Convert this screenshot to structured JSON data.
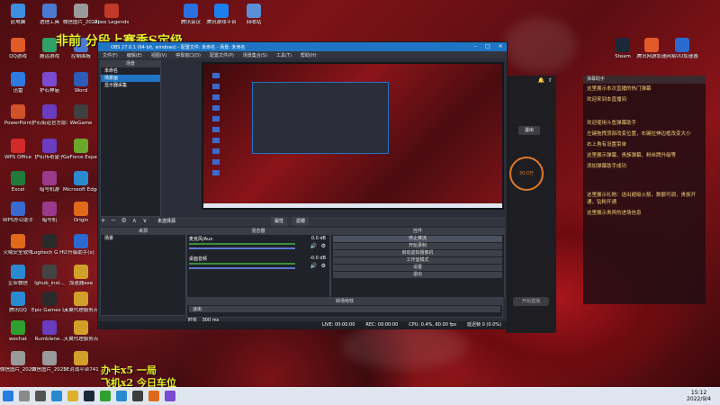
{
  "overlay": {
    "top_banner": "非前 分段上赛季S定级",
    "bottom_line1": "办卡x5 一局",
    "bottom_line2": "飞机x2 今日车位"
  },
  "desktop_icons": [
    {
      "label": "此电脑",
      "color": "#3d8fe0"
    },
    {
      "label": "透理工具",
      "color": "#4a7ad0"
    },
    {
      "label": "微信图片_2022072...",
      "color": "#9a9a9a"
    },
    {
      "label": "Apex Legends",
      "color": "#c0392b"
    },
    {
      "label": "腾讯会议",
      "color": "#2a6fe0"
    },
    {
      "label": "腾讯游戏平台",
      "color": "#1c7ef0"
    },
    {
      "label": "回收站",
      "color": "#5a8fd6"
    },
    {
      "label": "QQ游戏",
      "color": "#e05a2a"
    },
    {
      "label": "搬运游戏",
      "color": "#2fa06a"
    },
    {
      "label": "控制面板",
      "color": "#4a7ad0"
    },
    {
      "label": "迅雷",
      "color": "#2d7be0"
    },
    {
      "label": "护石神庙",
      "color": "#7a4bd0"
    },
    {
      "label": "Word",
      "color": "#2b5cb8"
    },
    {
      "label": "PowerPoint",
      "color": "#d0532a"
    },
    {
      "label": "护石街道官方版本",
      "color": "#6a3cc0"
    },
    {
      "label": "WeGame",
      "color": "#3f3f3f"
    },
    {
      "label": "WPS Office",
      "color": "#d02a2a"
    },
    {
      "label": "护石传奇盒子",
      "color": "#6a3cc0"
    },
    {
      "label": "GeForce Experience",
      "color": "#6aa82a"
    },
    {
      "label": "Excel",
      "color": "#1f7a3c"
    },
    {
      "label": "暗号机游",
      "color": "#9a3a8a"
    },
    {
      "label": "Microsoft Edge",
      "color": "#2a8ad0"
    },
    {
      "label": "WPS办公助手",
      "color": "#3a6ad0"
    },
    {
      "label": "暗号机",
      "color": "#9a3a8a"
    },
    {
      "label": "Origin",
      "color": "#e06a1a"
    },
    {
      "label": "火绒安全软件",
      "color": "#e06a1a"
    },
    {
      "label": "Logitech G HUB",
      "color": "#2a2a2a"
    },
    {
      "label": "升级助手(x)",
      "color": "#2a6ad0"
    },
    {
      "label": "企业微信",
      "color": "#2a8ad0"
    },
    {
      "label": "lghub_inst...",
      "color": "#444"
    },
    {
      "label": "加速器exe",
      "color": "#d0a02a"
    },
    {
      "label": "腾讯QQ",
      "color": "#2a8ad0"
    },
    {
      "label": "Epic Games Launcher",
      "color": "#2a2a2a"
    },
    {
      "label": "天翼代理服务点",
      "color": "#d0a02a"
    },
    {
      "label": "wechat",
      "color": "#2fa02f"
    },
    {
      "label": "Rumblene...",
      "color": "#6a3cc0"
    },
    {
      "label": "天翼代理服务点",
      "color": "#d0a02a"
    },
    {
      "label": "微信图片_2022081...",
      "color": "#9a9a9a"
    },
    {
      "label": "微信图片_2022083...",
      "color": "#9a9a9a"
    },
    {
      "label": "5E对战平台741",
      "color": "#d0a02a"
    },
    {
      "label": "Steam",
      "color": "#1b2838"
    },
    {
      "label": "腾讯网游加速",
      "color": "#e05a2a"
    },
    {
      "label": "网易UU加速器",
      "color": "#2a6ad0"
    }
  ],
  "obs": {
    "title": "OBS 27.0.1 (64-bit, windows) - 配置文件: 未命名 - 场景: 未命名",
    "menu": [
      "文件(F)",
      "编辑(E)",
      "视图(V)",
      "停靠窗口(D)",
      "配置文件(P)",
      "场景集合(S)",
      "工具(T)",
      "帮助(H)"
    ],
    "scenes_header": "场景",
    "scenes": [
      "未命名",
      "场景画",
      "显示器采集"
    ],
    "sources_header": "来源",
    "sources": [
      "场景"
    ],
    "status_line": "未选择源",
    "props_label": "属性",
    "filters_label": "滤镜",
    "mixer_header": "混音器",
    "mixer_rows": [
      {
        "name": "麦克风/Aux",
        "db": "0.0 dB"
      },
      {
        "name": "桌面音频",
        "db": "-0.0 dB"
      }
    ],
    "transition_header": "转场特效",
    "transition_name": "淡出",
    "duration_label": "时长",
    "duration_value": "300 ms",
    "controls_header": "控件",
    "controls": [
      "停止推流",
      "开始录制",
      "启动虚拟摄像机",
      "工作室模式",
      "设置",
      "退出"
    ],
    "statusbar": {
      "live": "LIVE: 00:00:00",
      "rec": "REC: 00:00:00",
      "cpu": "CPU: 0.4%, 60.00 fps",
      "dropped": "延迟帧 0 (0.0%)"
    }
  },
  "live_assistant": {
    "button": "退出",
    "stat": "30.0万",
    "start_label": "开始直播"
  },
  "chat": {
    "title": "弹幕助手",
    "lines": [
      "这里展示本次直播的热门弹幕",
      "欢迎来到本直播间",
      "欢迎使用斗鱼弹幕助手",
      "左键拖拽顶部改变位置，右键拉伸边框改变大小",
      "右上角有设置菜单",
      "这里展示弹幕、贵族弹幕、粉丝牌升级等",
      "添加弹幕助手成功",
      "这里展示礼物：送出超级火箭，数额可调，贵族开通，钻粉开通",
      "这里展示贵宾的进场信息"
    ]
  },
  "taskbar": {
    "time": "15:12",
    "date": "2022/9/4"
  }
}
